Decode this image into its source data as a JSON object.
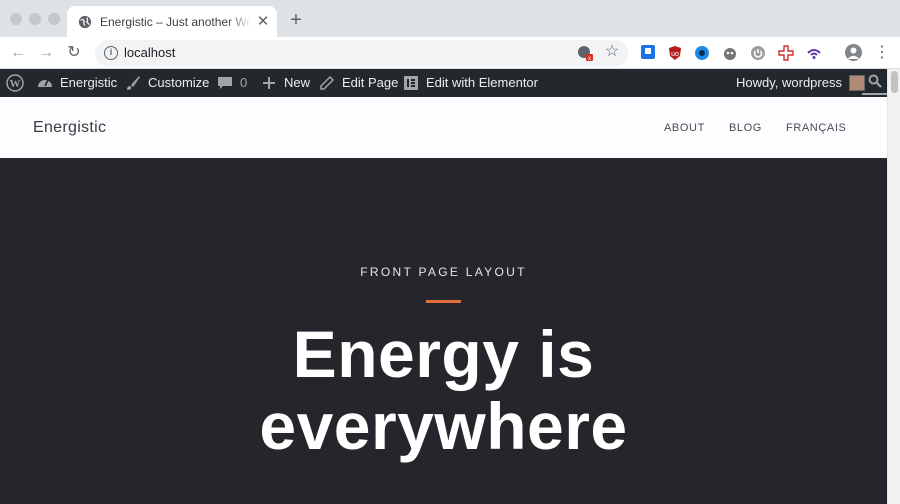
{
  "browser": {
    "tab_title": "Energistic – Just another WordPress site",
    "url": "localhost",
    "extension_badge": "9+"
  },
  "adminbar": {
    "site_name": "Energistic",
    "customize": "Customize",
    "comments_count": "0",
    "new": "New",
    "edit_page": "Edit Page",
    "edit_with_elementor": "Edit with Elementor",
    "howdy": "Howdy, wordpress"
  },
  "site": {
    "title": "Energistic",
    "nav": [
      "ABOUT",
      "BLOG",
      "FRANÇAIS"
    ]
  },
  "hero": {
    "eyebrow": "FRONT PAGE LAYOUT",
    "heading_line1": "Energy is",
    "heading_line2": "everywhere"
  },
  "colors": {
    "adminbar_bg": "#23282d",
    "hero_bg": "#25252b",
    "accent": "#e06b3b"
  }
}
